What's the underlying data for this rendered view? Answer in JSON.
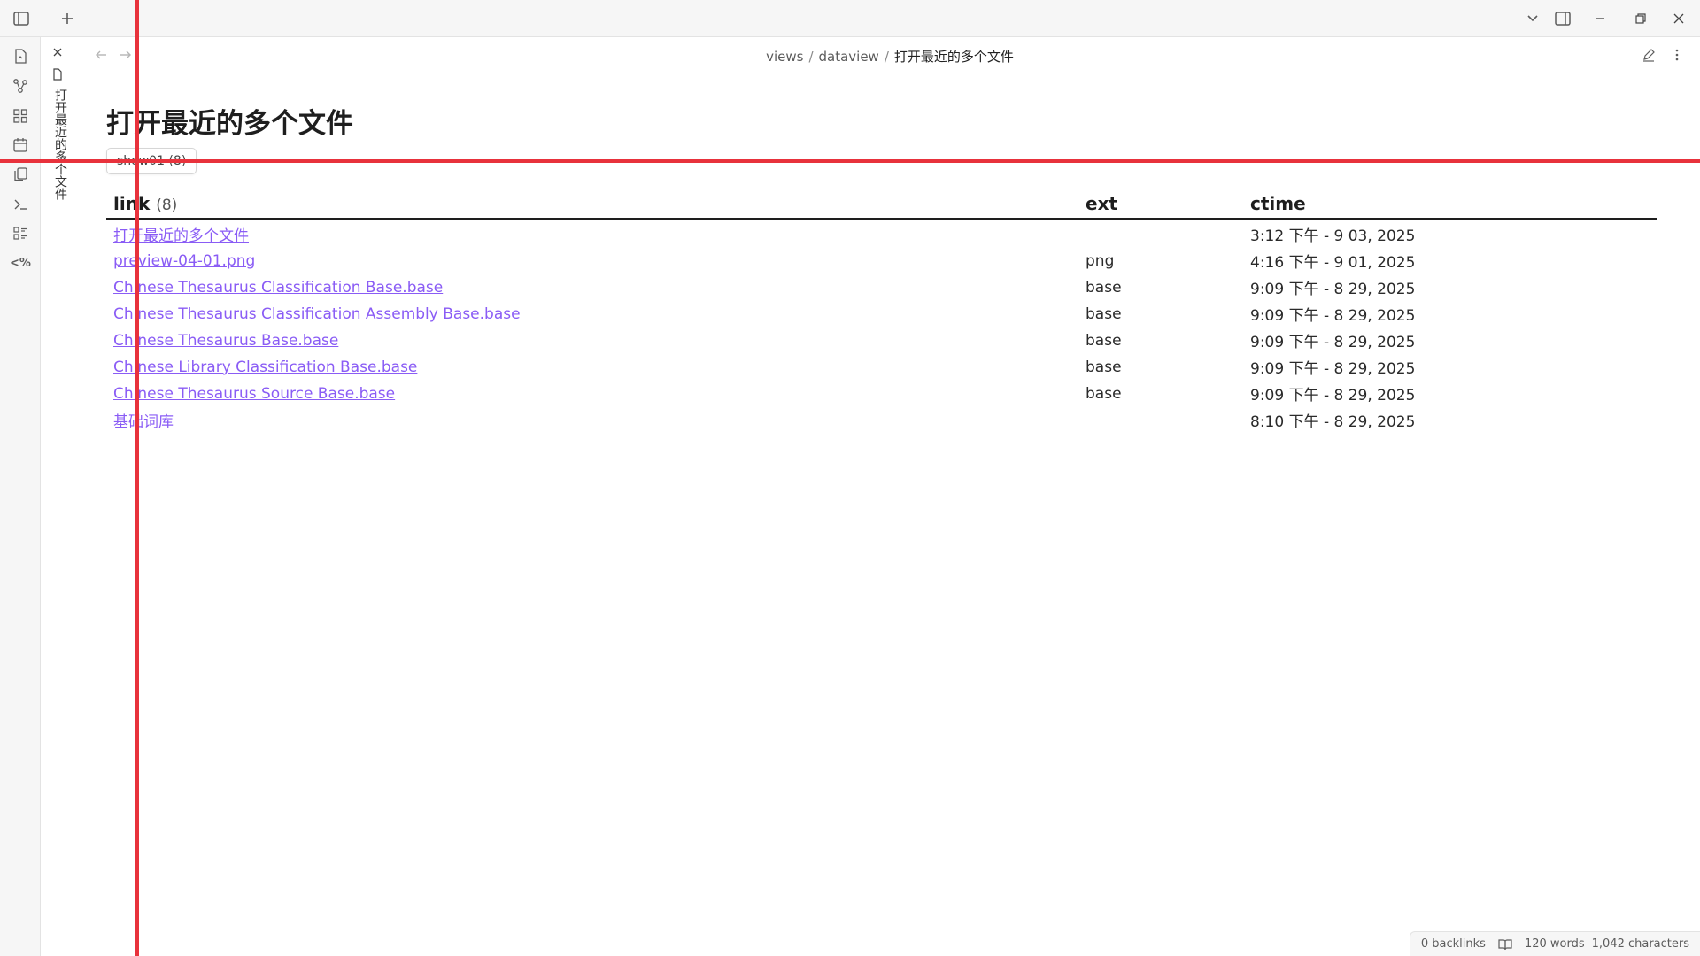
{
  "topbar": {
    "sidebar_toggle_icon": "sidebar-left-icon",
    "new_tab_icon": "plus-icon",
    "tab_list_icon": "chevron-down-icon",
    "right_sidebar_icon": "sidebar-right-icon",
    "minimize_icon": "minimize-icon",
    "restore_icon": "restore-icon",
    "close_icon": "close-icon"
  },
  "ribbon": {
    "items": [
      {
        "name": "file-switch-icon"
      },
      {
        "name": "graph-icon"
      },
      {
        "name": "canvas-icon"
      },
      {
        "name": "calendar-icon"
      },
      {
        "name": "copy-icon"
      },
      {
        "name": "terminal-icon"
      },
      {
        "name": "list-icon"
      },
      {
        "name": "templater-icon",
        "label": "<%"
      }
    ]
  },
  "tabstack": {
    "close_icon": "close-icon",
    "file_icon": "file-icon",
    "title": "打开最近的多个文件"
  },
  "header": {
    "back_icon": "arrow-left-icon",
    "forward_icon": "arrow-right-icon",
    "breadcrumb": [
      "views",
      "dataview",
      "打开最近的多个文件"
    ],
    "separator": "/",
    "edit_icon": "pencil-icon",
    "more_icon": "more-vertical-icon"
  },
  "page": {
    "title": "打开最近的多个文件",
    "group_label": "show01 (8)"
  },
  "table": {
    "headers": {
      "link": "link",
      "link_count": "(8)",
      "ext": "ext",
      "ctime": "ctime"
    },
    "rows": [
      {
        "link": "打开最近的多个文件",
        "ext": "",
        "ctime": "3:12 下午 - 9 03, 2025"
      },
      {
        "link": "preview-04-01.png",
        "ext": "png",
        "ctime": "4:16 下午 - 9 01, 2025"
      },
      {
        "link": "Chinese Thesaurus Classification Base.base",
        "ext": "base",
        "ctime": "9:09 下午 - 8 29, 2025"
      },
      {
        "link": "Chinese Thesaurus Classification Assembly Base.base",
        "ext": "base",
        "ctime": "9:09 下午 - 8 29, 2025"
      },
      {
        "link": "Chinese Thesaurus Base.base",
        "ext": "base",
        "ctime": "9:09 下午 - 8 29, 2025"
      },
      {
        "link": "Chinese Library Classification Base.base",
        "ext": "base",
        "ctime": "9:09 下午 - 8 29, 2025"
      },
      {
        "link": "Chinese Thesaurus Source Base.base",
        "ext": "base",
        "ctime": "9:09 下午 - 8 29, 2025"
      },
      {
        "link": "基础词库",
        "ext": "",
        "ctime": "8:10 下午 - 8 29, 2025"
      }
    ]
  },
  "statusbar": {
    "backlinks": "0 backlinks",
    "reading_icon": "book-open-icon",
    "words": "120 words",
    "characters": "1,042 characters"
  },
  "colors": {
    "link": "#8a5cf5",
    "guide_line": "#e8323c",
    "chrome_bg": "#f6f6f6"
  }
}
